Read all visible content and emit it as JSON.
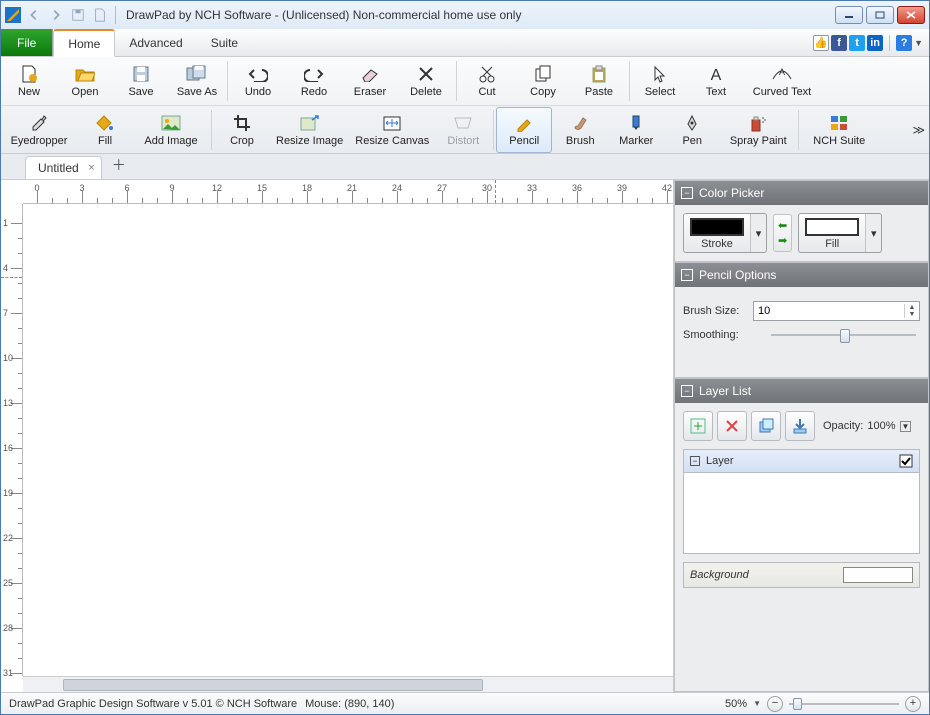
{
  "window": {
    "title": "DrawPad by NCH Software - (Unlicensed) Non-commercial home use only"
  },
  "menu": {
    "file": "File",
    "tabs": [
      "Home",
      "Advanced",
      "Suite"
    ],
    "active": "Home"
  },
  "ribbon": {
    "row1": [
      {
        "id": "new",
        "label": "New"
      },
      {
        "id": "open",
        "label": "Open"
      },
      {
        "id": "save",
        "label": "Save"
      },
      {
        "id": "saveas",
        "label": "Save As"
      },
      {
        "sep": true
      },
      {
        "id": "undo",
        "label": "Undo"
      },
      {
        "id": "redo",
        "label": "Redo"
      },
      {
        "id": "eraser",
        "label": "Eraser"
      },
      {
        "id": "delete",
        "label": "Delete"
      },
      {
        "sep": true
      },
      {
        "id": "cut",
        "label": "Cut"
      },
      {
        "id": "copy",
        "label": "Copy"
      },
      {
        "id": "paste",
        "label": "Paste"
      },
      {
        "sep": true
      },
      {
        "id": "select",
        "label": "Select"
      },
      {
        "id": "text",
        "label": "Text"
      },
      {
        "id": "curvedtext",
        "label": "Curved Text"
      }
    ],
    "row2": [
      {
        "id": "eyedropper",
        "label": "Eyedropper"
      },
      {
        "id": "fill",
        "label": "Fill"
      },
      {
        "id": "addimage",
        "label": "Add Image"
      },
      {
        "sep": true
      },
      {
        "id": "crop",
        "label": "Crop"
      },
      {
        "id": "resizeimage",
        "label": "Resize Image"
      },
      {
        "id": "resizecanvas",
        "label": "Resize Canvas"
      },
      {
        "id": "distort",
        "label": "Distort",
        "disabled": true
      },
      {
        "sep": true
      },
      {
        "id": "pencil",
        "label": "Pencil",
        "selected": true
      },
      {
        "id": "brush",
        "label": "Brush"
      },
      {
        "id": "marker",
        "label": "Marker"
      },
      {
        "id": "pen",
        "label": "Pen"
      },
      {
        "id": "spraypaint",
        "label": "Spray Paint"
      },
      {
        "sep": true
      },
      {
        "id": "nchsuite",
        "label": "NCH Suite"
      }
    ]
  },
  "doc": {
    "tab": "Untitled"
  },
  "ruler": {
    "h_major": [
      0,
      3,
      6,
      9,
      12,
      15,
      18,
      21,
      24,
      27,
      30,
      33,
      36,
      39,
      42
    ],
    "v_major": [
      1,
      4,
      7,
      10,
      13,
      16,
      19,
      22,
      25,
      28,
      31
    ],
    "h_guide_at": 30.5,
    "v_guide_at": 4.6
  },
  "panels": {
    "color": {
      "title": "Color Picker",
      "stroke_label": "Stroke",
      "fill_label": "Fill"
    },
    "pencil": {
      "title": "Pencil Options",
      "brush_label": "Brush Size:",
      "brush_value": "10",
      "smoothing_label": "Smoothing:"
    },
    "layers": {
      "title": "Layer List",
      "opacity_label": "Opacity:",
      "opacity_value": "100%",
      "layer_name": "Layer",
      "background": "Background"
    }
  },
  "status": {
    "left": "DrawPad Graphic Design Software v 5.01 © NCH Software",
    "mouse": "Mouse: (890, 140)",
    "zoom": "50%"
  }
}
